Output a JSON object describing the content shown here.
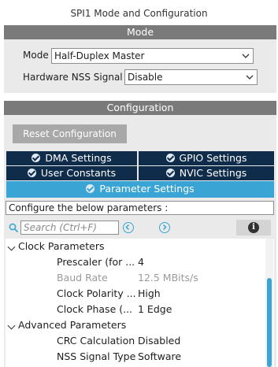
{
  "title": "SPI1 Mode and Configuration",
  "mode": {
    "header": "Mode",
    "mode_label": "Mode",
    "mode_value": "Half-Duplex Master",
    "nss_label": "Hardware NSS Signal",
    "nss_value": "Disable"
  },
  "configuration": {
    "header": "Configuration",
    "reset_button": "Reset Configuration",
    "tabs": [
      {
        "label": "DMA Settings"
      },
      {
        "label": "GPIO Settings"
      },
      {
        "label": "User Constants"
      },
      {
        "label": "NVIC Settings"
      },
      {
        "label": "Parameter Settings",
        "active": true
      }
    ],
    "description": "Configure the below parameters :",
    "search_placeholder": "Search (Ctrl+F)",
    "prev_icon": "circle-chevron-left-icon",
    "next_icon": "circle-chevron-right-icon",
    "info_icon": "info-icon",
    "groups": [
      {
        "label": "Clock Parameters",
        "params": [
          {
            "name": "Prescaler (for ...",
            "value": "4"
          },
          {
            "name": "Baud Rate",
            "value": "12.5 MBits/s",
            "disabled": true
          },
          {
            "name": "Clock Polarity ...",
            "value": "High"
          },
          {
            "name": "Clock Phase (...",
            "value": "1 Edge"
          }
        ]
      },
      {
        "label": "Advanced Parameters",
        "params": [
          {
            "name": "CRC Calculation",
            "value": "Disabled"
          },
          {
            "name": "NSS Signal Type",
            "value": "Software"
          }
        ]
      }
    ]
  },
  "colors": {
    "section_bar": "#7a7a7a",
    "tab_dark": "#0f2d4b",
    "tab_active": "#3aa5d4",
    "panel_bg": "#eaeaea"
  }
}
